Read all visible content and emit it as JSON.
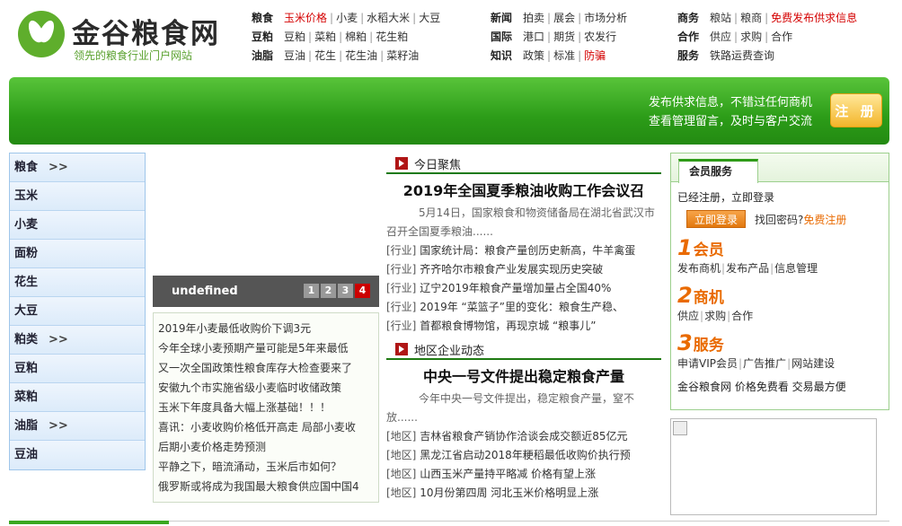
{
  "logo": {
    "name": "金谷粮食网",
    "slogan": "领先的粮食行业门户网站"
  },
  "nav": [
    {
      "rows": [
        {
          "head": "粮食",
          "items": [
            {
              "t": "玉米价格",
              "red": true
            },
            {
              "t": "小麦"
            },
            {
              "t": "水稻大米"
            },
            {
              "t": "大豆"
            }
          ]
        },
        {
          "head": "豆粕",
          "items": [
            {
              "t": "豆粕"
            },
            {
              "t": "菜粕"
            },
            {
              "t": "棉粕"
            },
            {
              "t": "花生粕"
            }
          ]
        },
        {
          "head": "油脂",
          "items": [
            {
              "t": "豆油"
            },
            {
              "t": "花生"
            },
            {
              "t": "花生油"
            },
            {
              "t": "菜籽油"
            }
          ]
        }
      ]
    },
    {
      "rows": [
        {
          "head": "新闻",
          "items": [
            {
              "t": "拍卖"
            },
            {
              "t": "展会"
            },
            {
              "t": "市场分析"
            }
          ]
        },
        {
          "head": "国际",
          "items": [
            {
              "t": "港口"
            },
            {
              "t": "期货"
            },
            {
              "t": "农发行"
            }
          ]
        },
        {
          "head": "知识",
          "items": [
            {
              "t": "政策"
            },
            {
              "t": "标准"
            },
            {
              "t": "防骗",
              "red": true
            }
          ]
        }
      ]
    },
    {
      "rows": [
        {
          "head": "商务",
          "items": [
            {
              "t": "粮站"
            },
            {
              "t": "粮商"
            },
            {
              "t": "免费发布供求信息",
              "red": true
            }
          ]
        },
        {
          "head": "合作",
          "items": [
            {
              "t": "供应"
            },
            {
              "t": "求购"
            },
            {
              "t": "合作"
            }
          ]
        },
        {
          "head": "服务",
          "items": [
            {
              "t": "铁路运费查询"
            }
          ]
        }
      ]
    }
  ],
  "banner": {
    "line1": "发布供求信息，不错过任何商机",
    "line2": "查看管理留言，及时与客户交流",
    "register": "注 册"
  },
  "sidebar": {
    "arrow": ">>",
    "items": [
      {
        "label": "粮食",
        "arrow": true
      },
      {
        "label": "玉米"
      },
      {
        "label": "小麦"
      },
      {
        "label": "面粉"
      },
      {
        "label": "花生"
      },
      {
        "label": "大豆"
      },
      {
        "label": "粕类",
        "arrow": true
      },
      {
        "label": "豆粕"
      },
      {
        "label": "菜粕"
      },
      {
        "label": "油脂",
        "arrow": true
      },
      {
        "label": "豆油"
      }
    ]
  },
  "slide": {
    "caption": "undefined",
    "pages": [
      "1",
      "2",
      "3",
      "4"
    ],
    "active": 3
  },
  "notices": [
    "2019年小麦最低收购价下调3元",
    "今年全球小麦预期产量可能是5年来最低",
    "又一次全国政策性粮食库存大检查要来了",
    "安徽九个市实施省级小麦临时收储政策",
    "玉米下年度具备大幅上涨基础！！！",
    "喜讯：小麦收购价格低开高走 局部小麦收",
    "后期小麦价格走势预测",
    "平静之下，暗流涌动，玉米后市如何？",
    "俄罗斯或将成为我国最大粮食供应国中国4"
  ],
  "focus": {
    "title": "今日聚焦",
    "headline": "2019年全国夏季粮油收购工作会议召",
    "summary": "5月14日，国家粮食和物资储备局在湖北省武汉市召开全国夏季粮油......",
    "items": [
      {
        "tag": "[行业]",
        "text": "国家统计局：粮食产量创历史新高，牛羊禽蛋"
      },
      {
        "tag": "[行业]",
        "text": "齐齐哈尔市粮食产业发展实现历史突破"
      },
      {
        "tag": "[行业]",
        "text": "辽宁2019年粮食产量增加量占全国40%"
      },
      {
        "tag": "[行业]",
        "text": "2019年 “菜篮子”里的变化：粮食生产稳、"
      },
      {
        "tag": "[行业]",
        "text": "首都粮食博物馆，再现京城 “粮事儿”"
      }
    ]
  },
  "region": {
    "title": "地区企业动态",
    "headline": "中央一号文件提出稳定粮食产量",
    "summary": "今年中央一号文件提出，稳定粮食产量，窒不放......",
    "items": [
      {
        "tag": "[地区]",
        "text": "吉林省粮食产销协作洽谈会成交额近85亿元"
      },
      {
        "tag": "[地区]",
        "text": "黑龙江省启动2018年粳稻最低收购价执行预"
      },
      {
        "tag": "[地区]",
        "text": "山西玉米产量持平略减 价格有望上涨"
      },
      {
        "tag": "[地区]",
        "text": "10月份第四周 河北玉米价格明显上涨"
      }
    ]
  },
  "member": {
    "tab": "会员服务",
    "line1": "已经注册，立即登录",
    "login": "立即登录",
    "forgot": "找回密码?",
    "freereg": "免费注册",
    "blocks": [
      {
        "num": "1",
        "title": "会员",
        "links": [
          "发布商机",
          "发布产品",
          "信息管理"
        ]
      },
      {
        "num": "2",
        "title": "商机",
        "links": [
          "供应",
          "求购",
          "合作"
        ]
      },
      {
        "num": "3",
        "title": "服务",
        "links": [
          "申请VIP会员",
          "广告推广",
          "网站建设"
        ]
      }
    ],
    "footer": "金谷粮食网 价格免费看 交易最方便"
  }
}
